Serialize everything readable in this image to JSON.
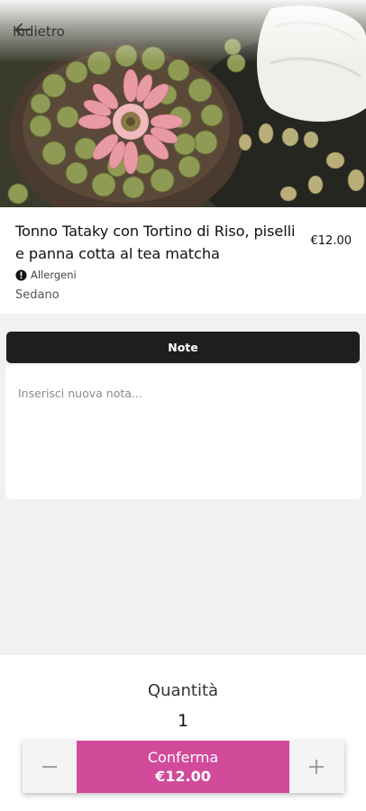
{
  "nav": {
    "back_label": "Indietro",
    "back_icon": "arrow-left-icon"
  },
  "product": {
    "title": "Tonno Tataky con Tortino di Riso, piselli e panna cotta al tea matcha",
    "price": "€12.00",
    "allergens_label": "Allergeni",
    "allergens": [
      "Sedano"
    ]
  },
  "notes": {
    "header": "Note",
    "placeholder": "Inserisci nuova nota..."
  },
  "quantity": {
    "label": "Quantità",
    "value": "1",
    "decrease_icon": "minus-icon",
    "increase_icon": "plus-icon"
  },
  "confirm": {
    "label": "Conferma",
    "price": "€12.00"
  },
  "colors": {
    "accent": "#d24a9a",
    "notes_header_bg": "#1e1e1e",
    "background": "#f1f1f1"
  }
}
